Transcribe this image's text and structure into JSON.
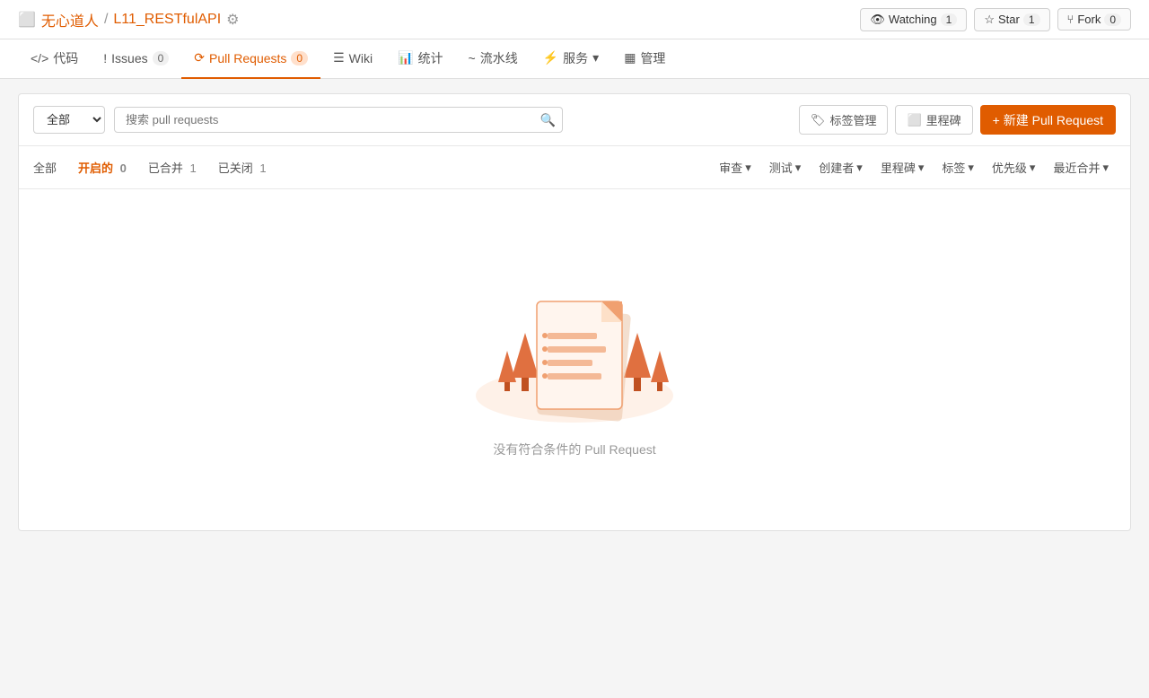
{
  "header": {
    "repo_user": "无心道人",
    "repo_separator": "/",
    "repo_name": "L11_RESTfulAPI",
    "gear_icon": "⚙",
    "watching_label": "Watching",
    "watching_count": "1",
    "star_label": "Star",
    "star_count": "1",
    "fork_label": "Fork",
    "fork_count": "0"
  },
  "nav": {
    "code_label": "代码",
    "issues_label": "Issues",
    "issues_count": "0",
    "pulls_label": "Pull Requests",
    "pulls_count": "0",
    "wiki_label": "Wiki",
    "stats_label": "统计",
    "pipeline_label": "流水线",
    "services_label": "服务",
    "manage_label": "管理"
  },
  "toolbar": {
    "filter_placeholder": "全部",
    "search_placeholder": "搜索 pull requests",
    "tags_label": "标签管理",
    "milestone_label": "里程碑",
    "new_pr_label": "+ 新建 Pull Request"
  },
  "filter_tabs": {
    "all_label": "全部",
    "open_label": "开启的",
    "open_count": "0",
    "merged_label": "已合并",
    "merged_count": "1",
    "closed_label": "已关闭",
    "closed_count": "1"
  },
  "filter_dropdowns": [
    {
      "label": "审查"
    },
    {
      "label": "测试"
    },
    {
      "label": "创建者"
    },
    {
      "label": "里程碑"
    },
    {
      "label": "标签"
    },
    {
      "label": "优先级"
    },
    {
      "label": "最近合并"
    }
  ],
  "empty_state": {
    "message": "没有符合条件的 Pull Request"
  }
}
